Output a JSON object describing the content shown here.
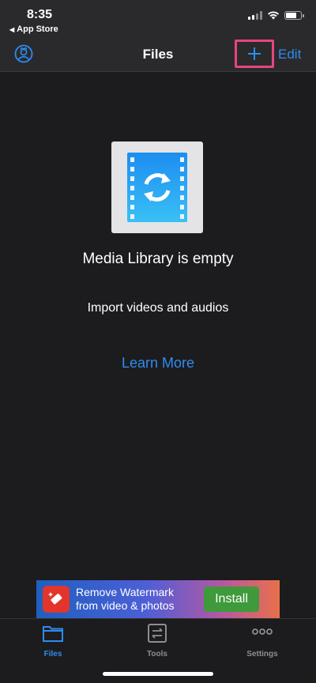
{
  "status_bar": {
    "time": "8:35",
    "back_app": "App Store",
    "battery_level": 0.75
  },
  "nav": {
    "title": "Files",
    "add_symbol": "+",
    "edit_label": "Edit",
    "profile_icon": "profile-icon",
    "highlight_color": "#e84482",
    "accent_color": "#2e8cf0"
  },
  "empty_state": {
    "icon": "video-library-icon",
    "title": "Media Library is empty",
    "subtitle": "Import videos and audios",
    "learn_more_label": "Learn More"
  },
  "ad": {
    "text_line1": "Remove Watermark",
    "text_line2": "from video & photos",
    "install_label": "Install",
    "icon": "eraser-icon"
  },
  "tabs": [
    {
      "label": "Files",
      "icon": "folder-icon",
      "active": true
    },
    {
      "label": "Tools",
      "icon": "tools-icon",
      "active": false
    },
    {
      "label": "Settings",
      "icon": "more-icon",
      "active": false
    }
  ]
}
